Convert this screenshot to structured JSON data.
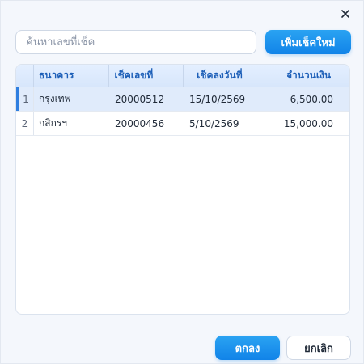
{
  "dialog": {
    "close_glyph": "×"
  },
  "search": {
    "placeholder": "ค้นหาเลขที่เช็ค",
    "value": ""
  },
  "toolbar": {
    "add_label": "เพิ่มเช็คใหม่"
  },
  "table": {
    "columns": [
      "ธนาคาร",
      "เช็คเลขที่",
      "เช็คลงวันที่",
      "จำนวนเงิน"
    ],
    "rows": [
      {
        "index": "1",
        "bank": "กรุงเทพ",
        "cheque_no": "20000512",
        "date": "15/10/2569",
        "amount": "6,500.00",
        "selected": true
      },
      {
        "index": "2",
        "bank": "กสิกรฯ",
        "cheque_no": "20000456",
        "date": "5/10/2569",
        "amount": "15,000.00",
        "selected": false
      }
    ]
  },
  "footer": {
    "ok_label": "ตกลง",
    "cancel_label": "ยกเลิก"
  },
  "colors": {
    "accent": "#1183e8",
    "header_text": "#1d5fb8",
    "selected_row": "#e0ebfb"
  }
}
